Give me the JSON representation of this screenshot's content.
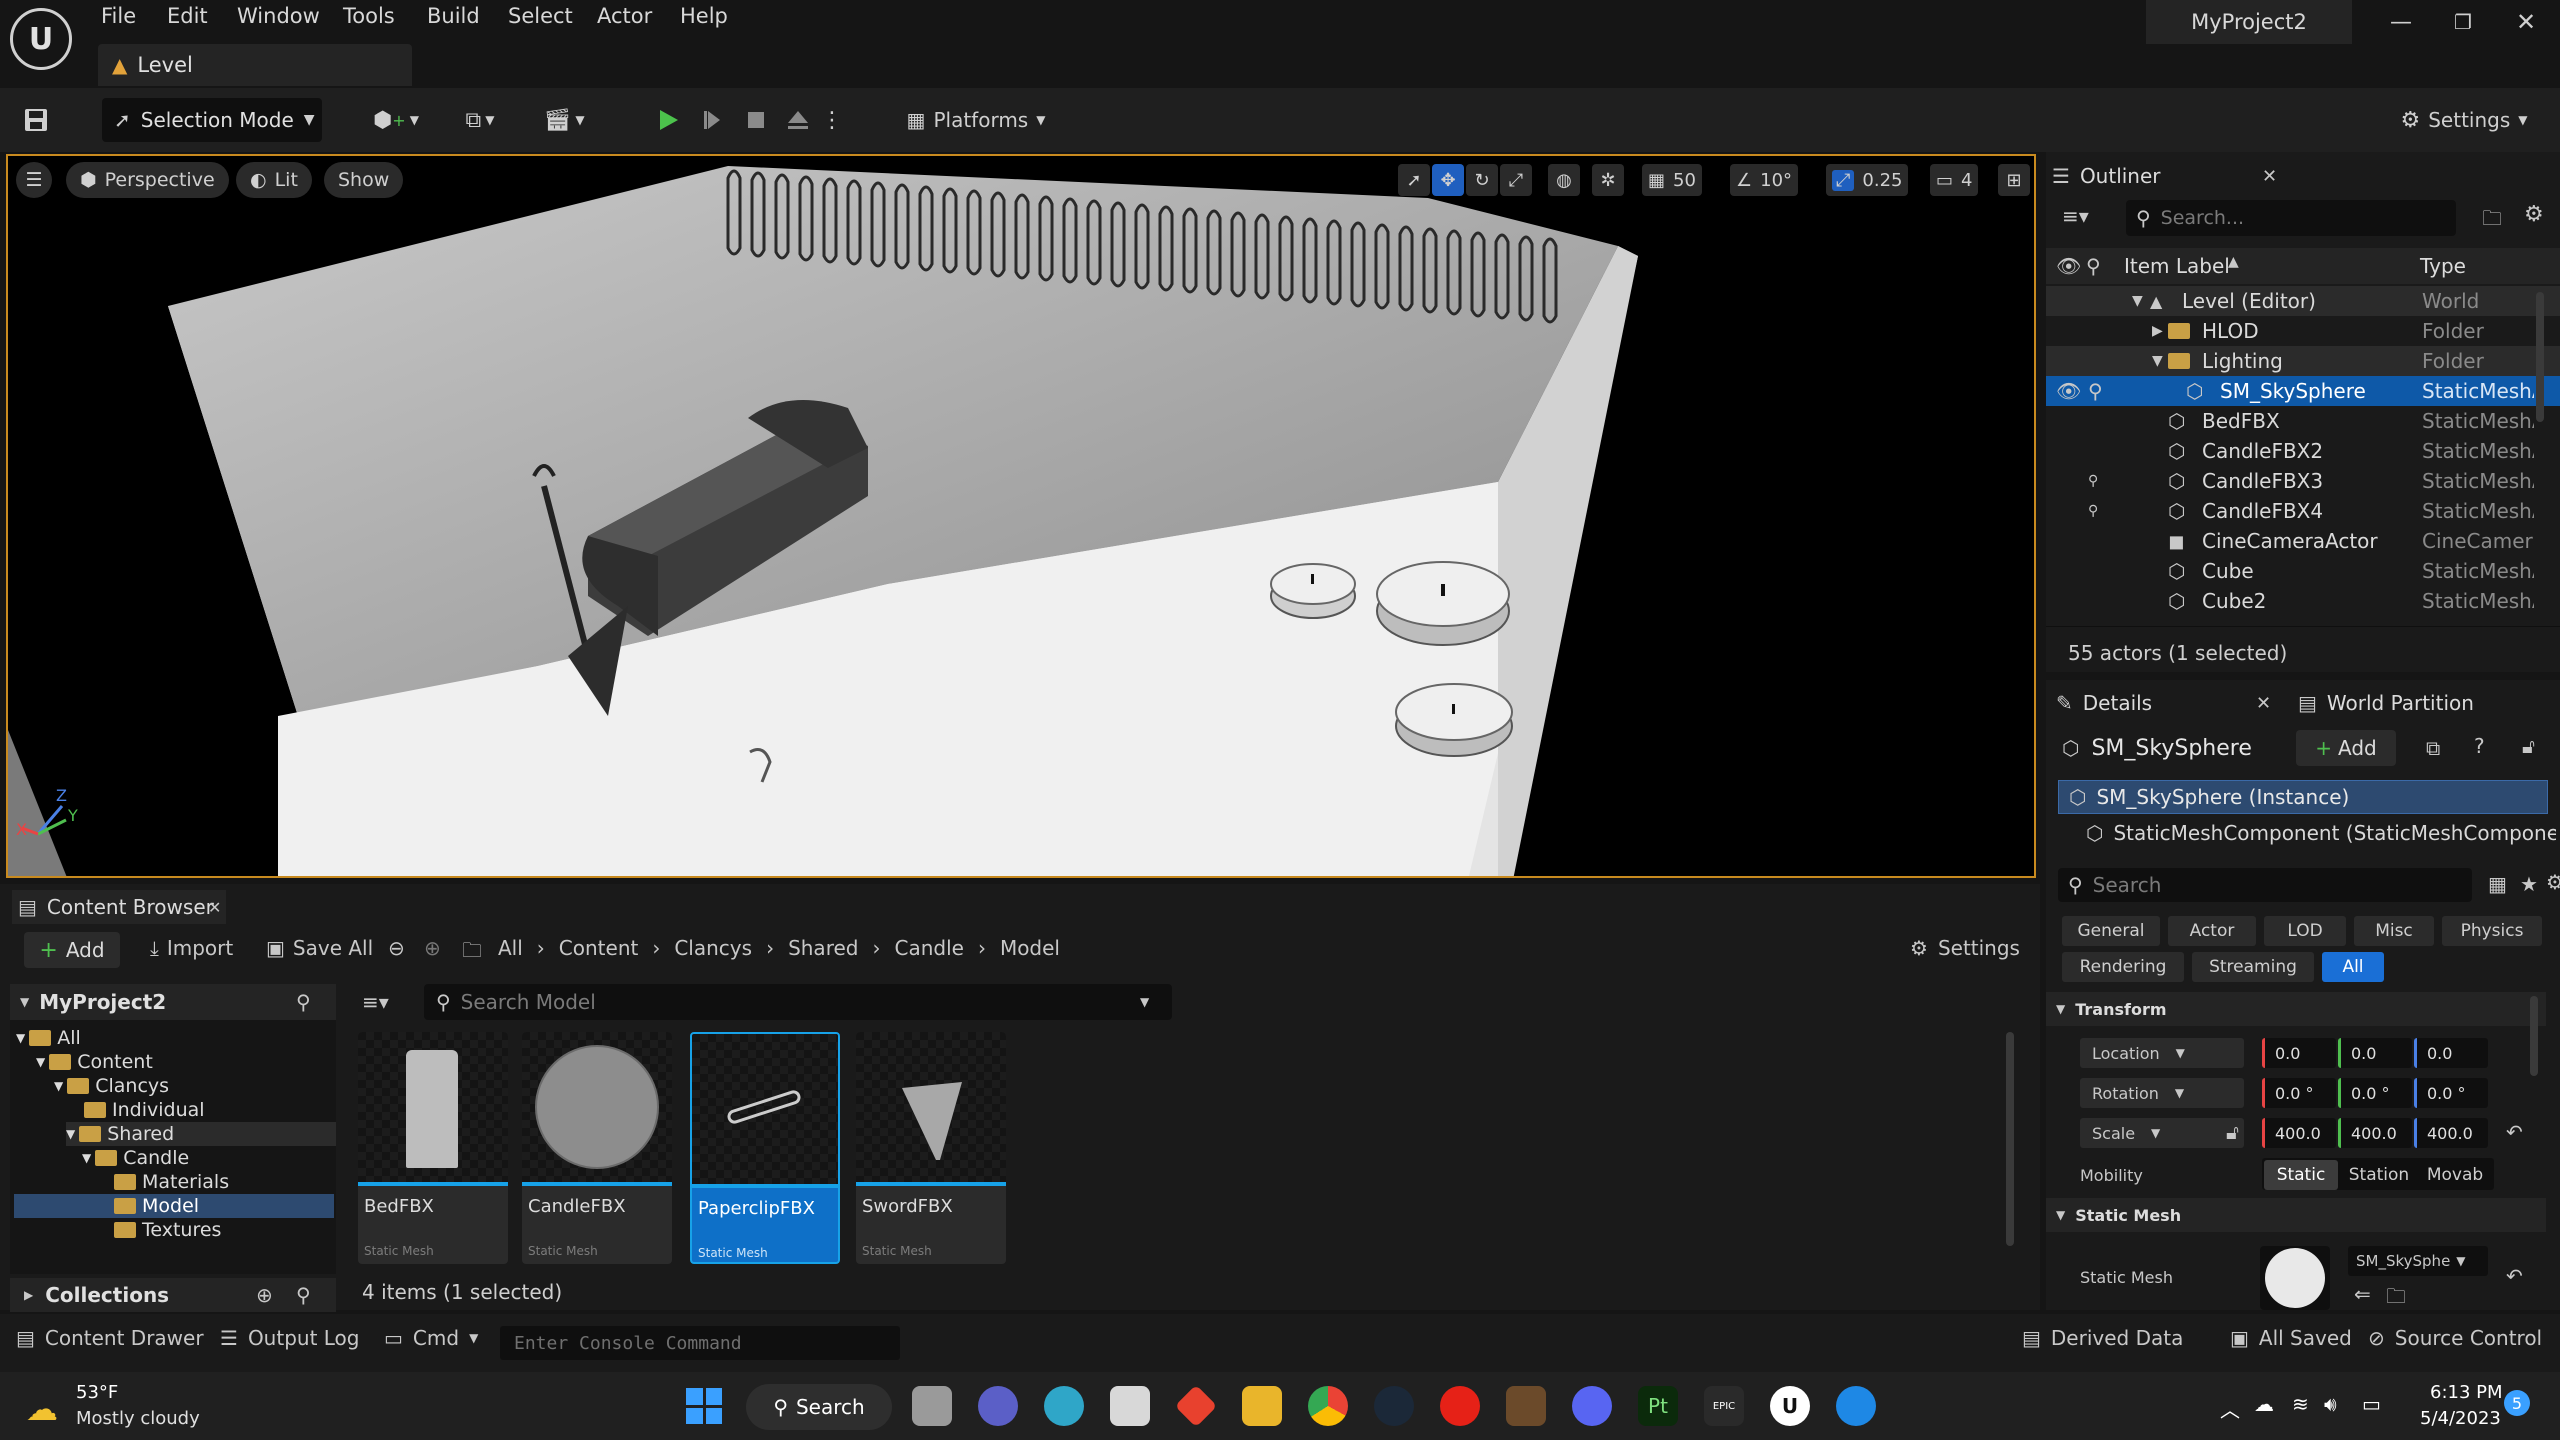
{
  "menu": [
    "File",
    "Edit",
    "Window",
    "Tools",
    "Build",
    "Select",
    "Actor",
    "Help"
  ],
  "project_title": "MyProject2",
  "level_tab": "Level",
  "toolbar": {
    "mode": "Selection Mode",
    "platforms": "Platforms",
    "settings": "Settings"
  },
  "viewport": {
    "perspective": "Perspective",
    "lit": "Lit",
    "show": "Show",
    "grid": "50",
    "angle": "10°",
    "scale": "0.25",
    "camera_speed": "4",
    "axis_x": "X",
    "axis_y": "Y",
    "axis_z": "Z"
  },
  "outliner": {
    "title": "Outliner",
    "search_placeholder": "Search...",
    "col_label": "Item Label",
    "col_type": "Type",
    "rows": [
      {
        "name": "Level (Editor)",
        "type": "World"
      },
      {
        "name": "HLOD",
        "type": "Folder"
      },
      {
        "name": "Lighting",
        "type": "Folder"
      },
      {
        "name": "SM_SkySphere",
        "type": "StaticMeshA"
      },
      {
        "name": "BedFBX",
        "type": "StaticMeshA"
      },
      {
        "name": "CandleFBX2",
        "type": "StaticMeshA"
      },
      {
        "name": "CandleFBX3",
        "type": "StaticMeshA"
      },
      {
        "name": "CandleFBX4",
        "type": "StaticMeshA"
      },
      {
        "name": "CineCameraActor",
        "type": "CineCamera"
      },
      {
        "name": "Cube",
        "type": "StaticMeshA"
      },
      {
        "name": "Cube2",
        "type": "StaticMeshA"
      }
    ],
    "footer": "55 actors (1 selected)"
  },
  "details": {
    "title": "Details",
    "world_partition": "World Partition",
    "object": "SM_SkySphere",
    "add": "Add",
    "instance": "SM_SkySphere (Instance)",
    "component": "StaticMeshComponent (StaticMeshComponen",
    "search_placeholder": "Search",
    "filters1": [
      "General",
      "Actor",
      "LOD",
      "Misc",
      "Physics"
    ],
    "filters2": [
      "Rendering",
      "Streaming",
      "All"
    ],
    "transform": "Transform",
    "location": "Location",
    "rotation": "Rotation",
    "scale_label": "Scale",
    "loc": [
      "0.0",
      "0.0",
      "0.0"
    ],
    "rot": [
      "0.0 °",
      "0.0 °",
      "0.0 °"
    ],
    "scl": [
      "400.0",
      "400.0",
      "400.0"
    ],
    "mobility": "Mobility",
    "mobility_opts": [
      "Static",
      "Station",
      "Movab"
    ],
    "static_mesh_section": "Static Mesh",
    "static_mesh_label": "Static Mesh",
    "static_mesh_value": "SM_SkySphe"
  },
  "content_browser": {
    "title": "Content Browser",
    "add": "Add",
    "import": "Import",
    "save_all": "Save All",
    "breadcrumbs": [
      "All",
      "Content",
      "Clancys",
      "Shared",
      "Candle",
      "Model"
    ],
    "settings": "Settings",
    "project": "MyProject2",
    "search_placeholder": "Search Model",
    "tree": [
      "All",
      "Content",
      "Clancys",
      "Individual",
      "Shared",
      "Candle",
      "Materials",
      "Model",
      "Textures"
    ],
    "collections": "Collections",
    "assets": [
      {
        "name": "BedFBX",
        "type": "Static Mesh"
      },
      {
        "name": "CandleFBX",
        "type": "Static Mesh"
      },
      {
        "name": "PaperclipFBX",
        "type": "Static Mesh"
      },
      {
        "name": "SwordFBX",
        "type": "Static Mesh"
      }
    ],
    "count": "4 items (1 selected)"
  },
  "statusbar": {
    "content_drawer": "Content Drawer",
    "output_log": "Output Log",
    "cmd": "Cmd",
    "console_placeholder": "Enter Console Command",
    "derived_data": "Derived Data",
    "all_saved": "All Saved",
    "source_control": "Source Control"
  },
  "taskbar": {
    "temp": "53°F",
    "weather": "Mostly cloudy",
    "search": "Search",
    "time": "6:13 PM",
    "date": "5/4/2023",
    "badge": "5"
  }
}
